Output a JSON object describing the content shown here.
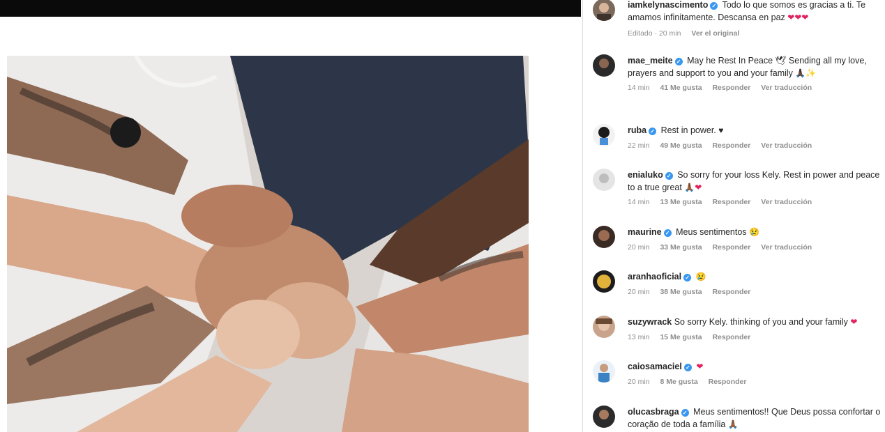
{
  "colors": {
    "verified": "#3897f0",
    "heart": "#e0245e"
  },
  "comments": [
    {
      "user": "iamkelynascimento",
      "verified": true,
      "text": "Todo lo que somos es gracias a ti. Te amamos infinitamente. Descansa en paz",
      "emoji": "❤❤❤",
      "time": "Editado · 20 min",
      "likes": "",
      "reply": "",
      "extra": "Ver el original"
    },
    {
      "user": "mae_meite",
      "verified": true,
      "text": "May he Rest In Peace 🕊 Sending all my love, prayers and support to you and your family",
      "emoji": "🙏🏿✨",
      "time": "14 min",
      "likes": "41 Me gusta",
      "reply": "Responder",
      "extra": "Ver traducción"
    },
    {
      "user": "ruba",
      "verified": true,
      "text": "Rest in power.",
      "emoji": "♥",
      "time": "22 min",
      "likes": "49 Me gusta",
      "reply": "Responder",
      "extra": "Ver traducción"
    },
    {
      "user": "enialuko",
      "verified": true,
      "text": "So sorry for your loss Kely. Rest in power and peace to a true great",
      "emoji": "🙏🏾❤",
      "time": "14 min",
      "likes": "13 Me gusta",
      "reply": "Responder",
      "extra": "Ver traducción"
    },
    {
      "user": "maurine",
      "verified": true,
      "text": "Meus sentimentos",
      "emoji": "😢",
      "time": "20 min",
      "likes": "33 Me gusta",
      "reply": "Responder",
      "extra": "Ver traducción"
    },
    {
      "user": "aranhaoficial",
      "verified": true,
      "text": "",
      "emoji": "😢",
      "time": "20 min",
      "likes": "38 Me gusta",
      "reply": "Responder",
      "extra": ""
    },
    {
      "user": "suzywrack",
      "verified": false,
      "text": "So sorry Kely. thinking of you and your family",
      "emoji": "❤",
      "time": "13 min",
      "likes": "15 Me gusta",
      "reply": "Responder",
      "extra": ""
    },
    {
      "user": "caiosamaciel",
      "verified": true,
      "text": "",
      "emoji": "❤",
      "time": "20 min",
      "likes": "8 Me gusta",
      "reply": "Responder",
      "extra": ""
    },
    {
      "user": "olucasbraga",
      "verified": true,
      "text": "Meus sentimentos!! Que Deus possa confortar o coração de toda a família",
      "emoji": "🙏🏾",
      "time": "",
      "likes": "",
      "reply": "",
      "extra": ""
    }
  ]
}
